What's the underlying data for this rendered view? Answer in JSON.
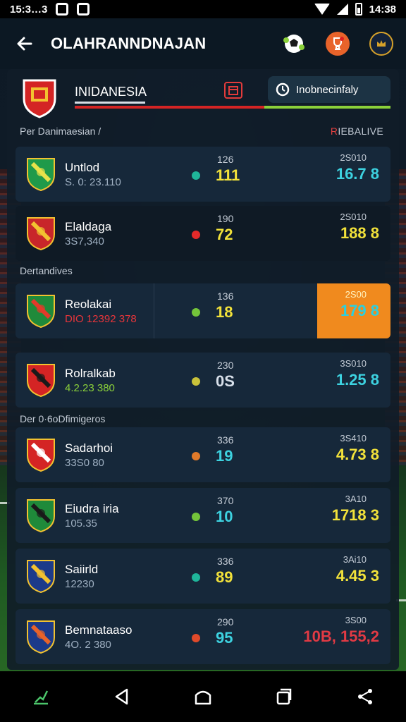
{
  "statusbar": {
    "time_left": "15:3…3",
    "time_right": "14:38"
  },
  "header": {
    "title": "OLAHRANNDNAJAN"
  },
  "hero": {
    "team": "INIDANESIA",
    "pill_label": "Inobnecinfaly"
  },
  "sections": {
    "s1_label": "Per Danimaesian /",
    "s1_right_prefix": "R",
    "s1_right": "IEBALIVE",
    "s2_label": "Dertandives",
    "s3_label": "Der 0·6oDfimigeros"
  },
  "rows": [
    {
      "name": "Untlod",
      "sub": "S. 0: 23.110",
      "small": "126",
      "mid": "111",
      "rtop": "2S010",
      "rval": "16.7 8",
      "dot": "#1fb59a",
      "midColor": "yellow",
      "rColor": "cyan"
    },
    {
      "name": "Elaldaga",
      "sub": "3S7,340",
      "small": "190",
      "mid": "72",
      "rtop": "2S010",
      "rval": "188 8",
      "dot": "#e32a2a",
      "midColor": "yellow",
      "rColor": "yellow"
    },
    {
      "name": "Reolakai",
      "sub": "DIO 12392 378",
      "small": "136",
      "mid": "18",
      "rtop": "2S00",
      "rval": "179 8",
      "dot": "#74c43a",
      "midColor": "yellow",
      "rColor": "cyan"
    },
    {
      "name": "Rolralkab",
      "sub": "4.2.23 380",
      "small": "230",
      "mid": "0S",
      "rtop": "3S010",
      "rval": "1.25 8",
      "dot": "#c9c23a",
      "midColor": "white",
      "rColor": "cyan"
    },
    {
      "name": "Sadarhoi",
      "sub": "33S0 80",
      "small": "336",
      "mid": "19",
      "rtop": "3S410",
      "rval": "4.73 8",
      "dot": "#e07a2a",
      "midColor": "cyan",
      "rColor": "yellow"
    },
    {
      "name": "Eiudra iria",
      "sub": "105.35",
      "small": "370",
      "mid": "10",
      "rtop": "3A10",
      "rval": "1718 3",
      "dot": "#74c43a",
      "midColor": "cyan",
      "rColor": "yellow"
    },
    {
      "name": "Saiirld",
      "sub": "12230",
      "small": "336",
      "mid": "89",
      "rtop": "3Ai10",
      "rval": "4.45 3",
      "dot": "#1fb59a",
      "midColor": "yellow",
      "rColor": "yellow"
    },
    {
      "name": "Bemnataaso",
      "sub": "4O. 2 380",
      "small": "290",
      "mid": "95",
      "rtop": "3S00",
      "rval": "10B, 155,2",
      "dot": "#e04a2a",
      "midColor": "cyan",
      "rColor": "red"
    }
  ]
}
